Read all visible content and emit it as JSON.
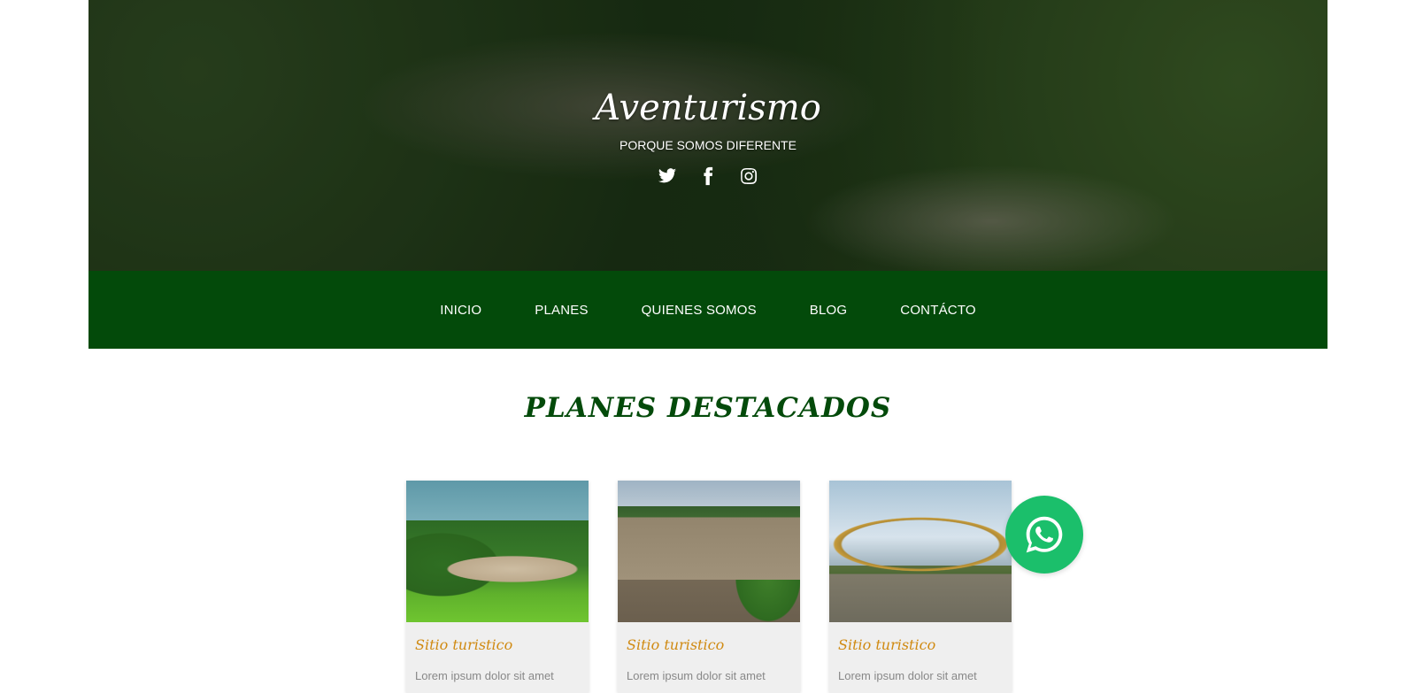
{
  "hero": {
    "title": "Aventurismo",
    "subtitle": "PORQUE SOMOS DIFERENTE",
    "socials": [
      "twitter-icon",
      "facebook-icon",
      "instagram-icon"
    ]
  },
  "nav": {
    "items": [
      "INICIO",
      "PLANES",
      "QUIENES SOMOS",
      "BLOG",
      "CONTÁCTO"
    ]
  },
  "section": {
    "title": "PLANES DESTACADOS",
    "cards": [
      {
        "title": "Sitio turistico",
        "text": "Lorem ipsum dolor sit amet"
      },
      {
        "title": "Sitio turistico",
        "text": "Lorem ipsum dolor sit amet"
      },
      {
        "title": "Sitio turistico",
        "text": "Lorem ipsum dolor sit amet"
      }
    ]
  },
  "fab": {
    "icon": "whatsapp-icon"
  },
  "colors": {
    "nav_bg": "#034a0a",
    "section_title": "#034a0a",
    "card_title": "#d08a12",
    "whatsapp": "#1bbf6b"
  }
}
